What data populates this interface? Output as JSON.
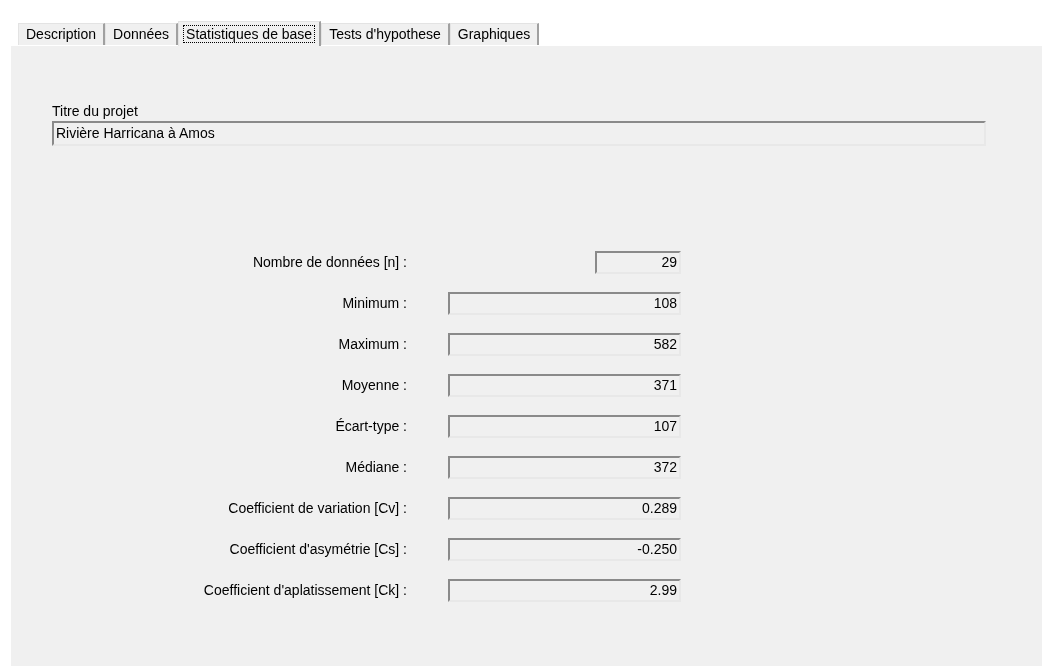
{
  "tabs": [
    {
      "label": "Description",
      "selected": false
    },
    {
      "label": "Données",
      "selected": false
    },
    {
      "label": "Statistiques de base",
      "selected": true
    },
    {
      "label": "Tests d'hypothese",
      "selected": false
    },
    {
      "label": "Graphiques",
      "selected": false
    }
  ],
  "project": {
    "label": "Titre du projet",
    "value": "Rivière Harricana à Amos"
  },
  "stats": [
    {
      "label": "Nombre de données [n] :",
      "value": "29",
      "kind": "short"
    },
    {
      "label": "Minimum :",
      "value": "108",
      "kind": "wide"
    },
    {
      "label": "Maximum :",
      "value": "582",
      "kind": "wide"
    },
    {
      "label": "Moyenne :",
      "value": "371",
      "kind": "wide"
    },
    {
      "label": "Écart-type :",
      "value": "107",
      "kind": "wide"
    },
    {
      "label": "Médiane :",
      "value": "372",
      "kind": "wide"
    },
    {
      "label": "Coefficient de variation [Cv] :",
      "value": "0.289",
      "kind": "wide"
    },
    {
      "label": "Coefficient d'asymétrie [Cs] :",
      "value": "-0.250",
      "kind": "wide"
    },
    {
      "label": "Coefficient d'aplatissement [Ck] :",
      "value": "2.99",
      "kind": "wide"
    }
  ]
}
